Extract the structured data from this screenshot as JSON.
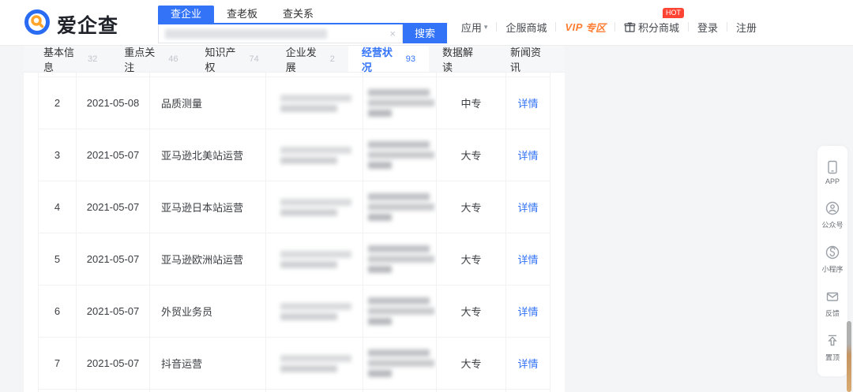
{
  "colors": {
    "primary_blue": "#3273f8",
    "link_blue": "#3273f8",
    "vip_orange": "#ff7e33",
    "hot_red": "#ff4433"
  },
  "header": {
    "logo_text": "爱企查",
    "search": {
      "tabs": [
        {
          "label": "查企业"
        },
        {
          "label": "查老板"
        },
        {
          "label": "查关系"
        }
      ],
      "clear_icon": "×",
      "button": "搜索"
    },
    "utility": {
      "apps": "应用",
      "caret": "▾",
      "mall": "企服商城",
      "vip_prefix": "VIP",
      "vip_suffix": "专区",
      "points": "积分商城",
      "hot_badge": "HOT",
      "login": "登录",
      "register": "注册"
    }
  },
  "nav": {
    "tabs": [
      {
        "label": "基本信息",
        "count": "32"
      },
      {
        "label": "重点关注",
        "count": "46"
      },
      {
        "label": "知识产权",
        "count": "74"
      },
      {
        "label": "企业发展",
        "count": "2"
      },
      {
        "label": "经营状况",
        "count": "93"
      },
      {
        "label": "数据解读",
        "count": ""
      },
      {
        "label": "新闻资讯",
        "count": ""
      }
    ]
  },
  "table": {
    "rows": [
      {
        "index": "2",
        "date": "2021-05-08",
        "position": "品质测量",
        "education": "中专",
        "action": "详情"
      },
      {
        "index": "3",
        "date": "2021-05-07",
        "position": "亚马逊北美站运营",
        "education": "大专",
        "action": "详情"
      },
      {
        "index": "4",
        "date": "2021-05-07",
        "position": "亚马逊日本站运营",
        "education": "大专",
        "action": "详情"
      },
      {
        "index": "5",
        "date": "2021-05-07",
        "position": "亚马逊欧洲站运营",
        "education": "大专",
        "action": "详情"
      },
      {
        "index": "6",
        "date": "2021-05-07",
        "position": "外贸业务员",
        "education": "大专",
        "action": "详情"
      },
      {
        "index": "7",
        "date": "2021-05-07",
        "position": "抖音运营",
        "education": "大专",
        "action": "详情"
      }
    ]
  },
  "sidebar": {
    "items": [
      {
        "label": "APP"
      },
      {
        "label": "公众号"
      },
      {
        "label": "小程序"
      },
      {
        "label": "反馈"
      },
      {
        "label": "置顶"
      }
    ]
  }
}
